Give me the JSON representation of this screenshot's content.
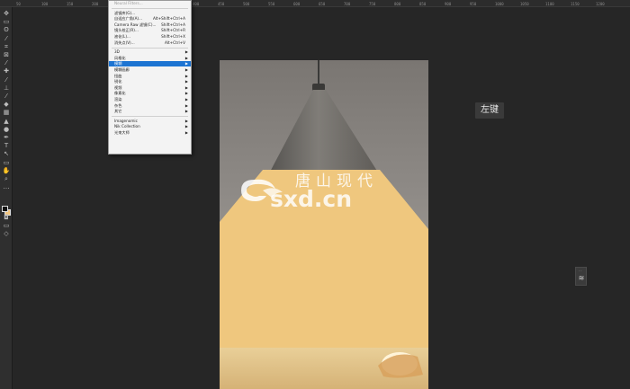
{
  "ruler": {
    "ticks": [
      "50",
      "100",
      "150",
      "200",
      "250",
      "300",
      "350",
      "400",
      "450",
      "500",
      "550",
      "600",
      "650",
      "700",
      "750",
      "800",
      "850",
      "900",
      "950",
      "1000",
      "1050",
      "1100",
      "1150",
      "1200"
    ]
  },
  "toolbar": {
    "tools": [
      {
        "name": "move-tool-icon",
        "glyph": "✥"
      },
      {
        "name": "marquee-tool-icon",
        "glyph": "▭"
      },
      {
        "name": "lasso-tool-icon",
        "glyph": "ʘ"
      },
      {
        "name": "quick-select-tool-icon",
        "glyph": "⁄"
      },
      {
        "name": "crop-tool-icon",
        "glyph": "⌗"
      },
      {
        "name": "frame-tool-icon",
        "glyph": "⊠"
      },
      {
        "name": "eyedropper-tool-icon",
        "glyph": "⁄"
      },
      {
        "name": "healing-brush-tool-icon",
        "glyph": "✚"
      },
      {
        "name": "brush-tool-icon",
        "glyph": "⁄"
      },
      {
        "name": "clone-stamp-tool-icon",
        "glyph": "⊥"
      },
      {
        "name": "history-brush-tool-icon",
        "glyph": "⁄"
      },
      {
        "name": "eraser-tool-icon",
        "glyph": "◆"
      },
      {
        "name": "gradient-tool-icon",
        "glyph": "▦"
      },
      {
        "name": "blur-tool-icon",
        "glyph": "▲"
      },
      {
        "name": "dodge-tool-icon",
        "glyph": "●"
      },
      {
        "name": "pen-tool-icon",
        "glyph": "✒"
      },
      {
        "name": "type-tool-icon",
        "glyph": "T"
      },
      {
        "name": "path-select-tool-icon",
        "glyph": "↖"
      },
      {
        "name": "shape-tool-icon",
        "glyph": "▭"
      },
      {
        "name": "hand-tool-icon",
        "glyph": "✋"
      },
      {
        "name": "zoom-tool-icon",
        "glyph": "⌕"
      },
      {
        "name": "more-tools-icon",
        "glyph": "…"
      }
    ],
    "bottom_tools": [
      {
        "name": "quick-mask-icon",
        "glyph": "◘"
      },
      {
        "name": "screen-mode-icon",
        "glyph": "▭"
      },
      {
        "name": "frame-mode-icon",
        "glyph": "◇"
      }
    ]
  },
  "menu": {
    "items": [
      {
        "label": "Neural Filters...",
        "shortcut": "",
        "type": "disabled"
      },
      {
        "type": "sep"
      },
      {
        "label": "滤镜库(G)...",
        "shortcut": ""
      },
      {
        "label": "自适应广角(A)...",
        "shortcut": "Alt+Shift+Ctrl+A"
      },
      {
        "label": "Camera Raw 滤镜(C)...",
        "shortcut": "Shift+Ctrl+A"
      },
      {
        "label": "镜头校正(R)...",
        "shortcut": "Shift+Ctrl+R"
      },
      {
        "label": "液化(L)...",
        "shortcut": "Shift+Ctrl+X"
      },
      {
        "label": "消失点(V)...",
        "shortcut": "Alt+Ctrl+V"
      },
      {
        "type": "sep"
      },
      {
        "label": "3D",
        "submenu": true
      },
      {
        "label": "风格化",
        "submenu": true
      },
      {
        "label": "模糊",
        "submenu": true,
        "type": "active"
      },
      {
        "label": "模糊画廊",
        "submenu": true
      },
      {
        "label": "扭曲",
        "submenu": true
      },
      {
        "label": "锐化",
        "submenu": true
      },
      {
        "label": "视频",
        "submenu": true
      },
      {
        "label": "像素化",
        "submenu": true
      },
      {
        "label": "渲染",
        "submenu": true
      },
      {
        "label": "杂色",
        "submenu": true
      },
      {
        "label": "其它",
        "submenu": true
      },
      {
        "type": "sep"
      },
      {
        "label": "Imagenomic",
        "submenu": true
      },
      {
        "label": "Nik Collection",
        "submenu": true
      },
      {
        "label": "光束大师",
        "submenu": true
      }
    ]
  },
  "tooltip": {
    "text": "左键"
  },
  "watermark": {
    "cn": "唐山现代",
    "en": "sxd.cn"
  },
  "mini_panel": {
    "dots": "··",
    "glyph": "≋"
  },
  "colors": {
    "foreground": "#111111",
    "background": "#f2c57e",
    "menu_highlight": "#1d74d2",
    "overlay_fill": "#efc77e"
  }
}
